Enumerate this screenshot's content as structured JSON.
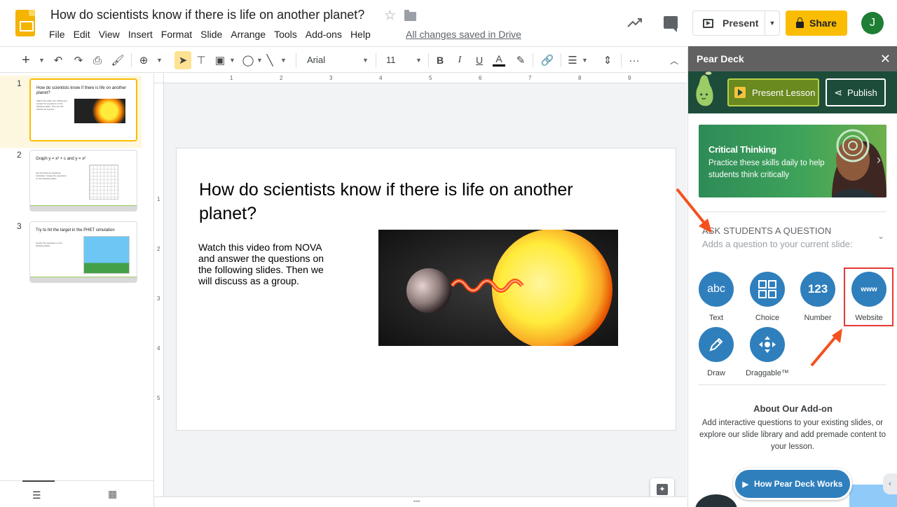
{
  "app": {
    "doc_title": "How do scientists know if there is life on another planet?",
    "menu": [
      "File",
      "Edit",
      "View",
      "Insert",
      "Format",
      "Slide",
      "Arrange",
      "Tools",
      "Add-ons",
      "Help"
    ],
    "save_status": "All changes saved in Drive",
    "present_label": "Present",
    "share_label": "Share",
    "avatar_initial": "J"
  },
  "toolbar": {
    "font": "Arial",
    "font_size": "11",
    "bold": "B",
    "italic": "I",
    "underline": "U",
    "text_color": "A",
    "more": "···"
  },
  "filmstrip": {
    "slides": [
      {
        "number": "1",
        "title": "How do scientists know if there is life on another planet?",
        "body": "Watch this video from NOVA and answer the questions on the following slides. Then we will discuss as a group."
      },
      {
        "number": "2",
        "title": "Graph y = x² + c and y = x²",
        "body": "Use the Desmos Graphing Calculator. Answer the questions on the following slides."
      },
      {
        "number": "3",
        "title": "Try to hit the target in the PHET simulation",
        "body": "Answer the questions on the following slides."
      }
    ]
  },
  "ruler": {
    "h": [
      "1",
      "2",
      "3",
      "4",
      "5",
      "6",
      "7",
      "8",
      "9"
    ],
    "v": [
      "1",
      "2",
      "3",
      "4",
      "5"
    ]
  },
  "slide": {
    "title": "How do scientists know if there is life on another planet?",
    "body": "Watch this video from NOVA and answer the questions on the following slides. Then we will discuss as a group."
  },
  "sidebar": {
    "title": "Pear Deck",
    "close": "✕",
    "present_lesson": "Present Lesson",
    "publish": "Publish",
    "promo": {
      "title": "Critical Thinking",
      "subtitle": "Practice these skills daily to help students think critically"
    },
    "ask": {
      "title": "ASK STUDENTS A QUESTION",
      "subtitle": "Adds a question to your current slide:",
      "types": [
        {
          "label": "Text",
          "glyph": "abc",
          "icon": "text-icon"
        },
        {
          "label": "Choice",
          "glyph": "",
          "icon": "choice-grid-icon"
        },
        {
          "label": "Number",
          "glyph": "123",
          "icon": "number-icon"
        },
        {
          "label": "Website",
          "glyph": "www",
          "icon": "website-icon"
        },
        {
          "label": "Draw",
          "glyph": "",
          "icon": "pencil-icon"
        },
        {
          "label": "Draggable™",
          "glyph": "",
          "icon": "drag-arrows-icon"
        }
      ]
    },
    "about": {
      "title": "About Our Add-on",
      "text": "Add interactive questions to your existing slides, or explore our slide library and add premade content to your lesson."
    },
    "how_works": "How Pear Deck Works"
  },
  "colors": {
    "share": "#fbbc04",
    "pear_banner": "#1d4c3a",
    "question_blue": "#2f7fbd",
    "highlight_red": "#e53935",
    "selected_slide": "#fbbc04"
  }
}
